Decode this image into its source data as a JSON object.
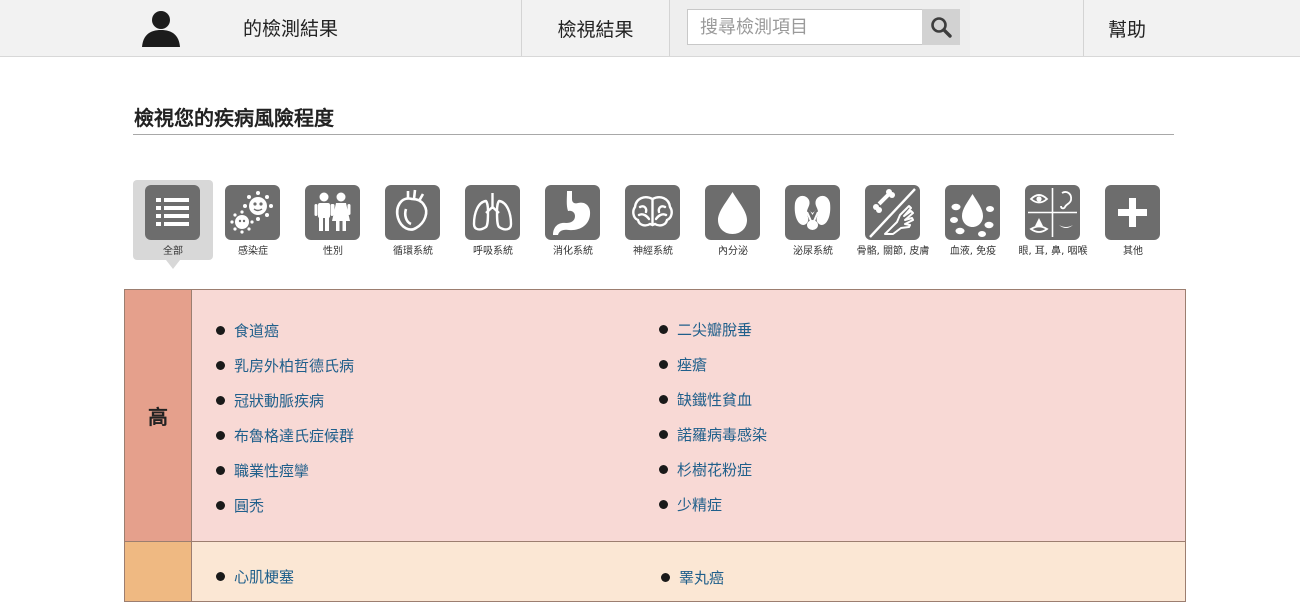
{
  "header": {
    "results_title": "的檢測結果",
    "view_results": "檢視結果",
    "search_placeholder": "搜尋檢測項目",
    "help": "幫助"
  },
  "section": {
    "title": "檢視您的疾病風險程度"
  },
  "categories": [
    {
      "label": "全部",
      "icon": "list-icon",
      "selected": true
    },
    {
      "label": "感染症",
      "icon": "virus-icon"
    },
    {
      "label": "性別",
      "icon": "gender-icon"
    },
    {
      "label": "循環系統",
      "icon": "heart-icon"
    },
    {
      "label": "呼吸系統",
      "icon": "lungs-icon"
    },
    {
      "label": "消化系統",
      "icon": "stomach-icon"
    },
    {
      "label": "神經系統",
      "icon": "brain-icon"
    },
    {
      "label": "內分泌",
      "icon": "drop-icon"
    },
    {
      "label": "泌尿系統",
      "icon": "kidney-icon"
    },
    {
      "label": "骨骼, 關節, 皮膚",
      "icon": "bone-icon"
    },
    {
      "label": "血液, 免疫",
      "icon": "blood-icon"
    },
    {
      "label": "眼, 耳, 鼻, 咽喉",
      "icon": "eye-ear-nose-mouth-icon"
    },
    {
      "label": "其他",
      "icon": "plus-icon"
    }
  ],
  "risk_levels": {
    "high": {
      "label": "高",
      "color": "#e5a08c",
      "background": "#f8d9d5",
      "left_items": [
        "食道癌",
        "乳房外柏哲德氏病",
        "冠狀動脈疾病",
        "布魯格達氏症候群",
        "職業性痙攣",
        "圓禿"
      ],
      "right_items": [
        "二尖瓣脫垂",
        "痤瘡",
        "缺鐵性貧血",
        "諾羅病毒感染",
        "杉樹花粉症",
        "少精症"
      ]
    },
    "medium": {
      "color": "#efb982",
      "background": "#fbe7d4",
      "left_items": [
        "心肌梗塞"
      ],
      "right_items": [
        "睪丸癌"
      ]
    }
  }
}
